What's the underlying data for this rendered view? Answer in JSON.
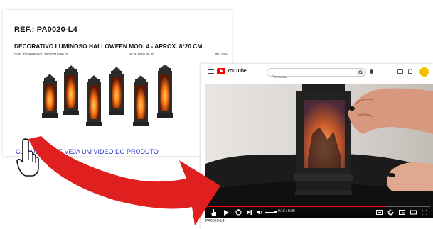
{
  "product_card": {
    "ref": "REF.: PA0020-L4",
    "description": "DECORATIVO LUMINOSO HALLOWEEN MOD. 4 - APROX. 8*20 CM",
    "specs": {
      "barcode": "CÓD. DE BARRAS: 7908221839616",
      "ncm": "NCM: 9505.90.00",
      "ipi": "IPI: 13%"
    },
    "cta_link": "CLIQUE AQUI E VEJA UM VIDEO DO PRODUTO"
  },
  "youtube": {
    "logo_text": "YouTube",
    "search_placeholder": "Pesquisar",
    "player": {
      "time": "0:16 / 0:20",
      "progress_fraction": 0.8,
      "volume_fraction": 0.85
    },
    "video_title": "PA0020-L4"
  },
  "colors": {
    "youtube_red": "#ff0000",
    "arrow_red": "#e0201f",
    "link_blue": "#2a35c9"
  },
  "icons": [
    "menu-icon",
    "youtube-logo-icon",
    "search-icon",
    "mic-icon",
    "create-icon",
    "bell-icon",
    "avatar",
    "play-icon",
    "next-icon",
    "volume-icon",
    "subtitles-icon",
    "settings-icon",
    "miniplayer-icon",
    "theater-icon",
    "fullscreen-icon",
    "hand-pointer-icon"
  ]
}
